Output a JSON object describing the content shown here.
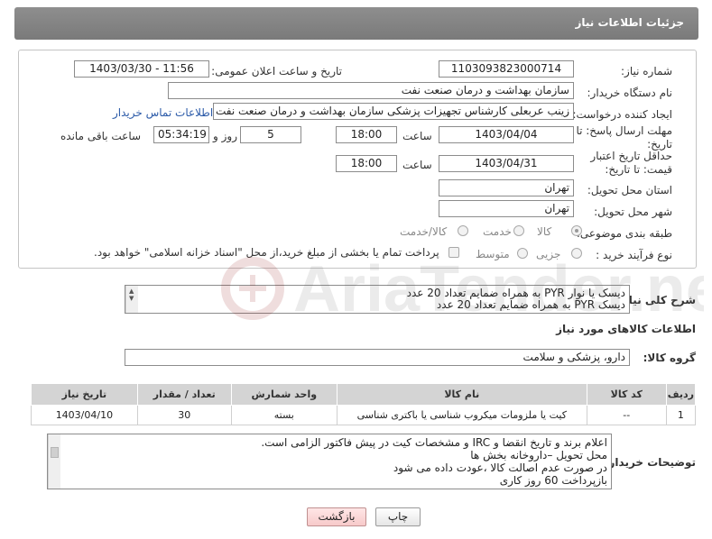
{
  "header": {
    "title": "جزئیات اطلاعات نیاز"
  },
  "form": {
    "need_number": {
      "label": "شماره نیاز:",
      "value": "1103093823000714"
    },
    "announce": {
      "label": "تاریخ و ساعت اعلان عمومی:",
      "value": "1403/03/30 - 11:56"
    },
    "buyer_org": {
      "label": "نام دستگاه خریدار:",
      "value": "سازمان بهداشت و درمان صنعت نفت"
    },
    "creator": {
      "label": "ایجاد کننده درخواست:",
      "value": "زینب عربعلی کارشناس تجهیزات پزشکی سازمان بهداشت و درمان صنعت نفت",
      "contact_link": "اطلاعات تماس خریدار"
    },
    "reply_deadline": {
      "label": "مهلت ارسال پاسخ: تا تاریخ:",
      "date": "1403/04/04",
      "time_label": "ساعت",
      "time": "18:00",
      "days": "5",
      "days_label": "روز و",
      "remaining": "05:34:19",
      "remaining_label": "ساعت باقی مانده"
    },
    "price_validity": {
      "label": "حداقل تاریخ اعتبار قیمت: تا تاریخ:",
      "date": "1403/04/31",
      "time_label": "ساعت",
      "time": "18:00"
    },
    "province": {
      "label": "استان محل تحویل:",
      "value": "تهران"
    },
    "city": {
      "label": "شهر محل تحویل:",
      "value": "تهران"
    },
    "category": {
      "label": "طبقه بندی موضوعی:",
      "options": [
        "کالا",
        "خدمت",
        "کالا/خدمت"
      ],
      "selected": "کالا"
    },
    "purchase_type": {
      "label": "نوع فرآیند خرید :",
      "options": [
        "جزیی",
        "متوسط"
      ],
      "payment_note": "پرداخت تمام یا بخشی از مبلغ خرید،از محل \"اسناد خزانه اسلامی\" خواهد بود."
    }
  },
  "description": {
    "label": "شرح کلی نیاز:",
    "lines": [
      "دیسک یا نوار PYR  به همراه ضمایم تعداد 20 عدد",
      "دیسک  PYR  به همراه ضمایم تعداد 20 عدد"
    ]
  },
  "goods_info": {
    "title": "اطلاعات کالاهای مورد نیاز"
  },
  "goods_group": {
    "label": "گروه کالا:",
    "value": "دارو، پزشکی و سلامت"
  },
  "goods_table": {
    "headers": [
      "ردیف",
      "کد کالا",
      "نام کالا",
      "واحد شمارش",
      "تعداد / مقدار",
      "تاریخ نیاز"
    ],
    "rows": [
      [
        "1",
        "--",
        "کیت یا ملزومات میکروب شناسی یا باکتری شناسی",
        "بسته",
        "30",
        "1403/04/10"
      ]
    ]
  },
  "buyer_notes": {
    "label": "توضیحات خریدار:",
    "lines": [
      "اعلام برند و تاریخ انقضا  و IRC  و مشخصات کیت در پیش فاکتور الزامی است.",
      "محل تحویل –داروخانه بخش ها",
      "در صورت عدم اصالت کالا ،عودت داده می شود",
      "بازپرداخت 60 روز کاری"
    ]
  },
  "buttons": {
    "print": "چاپ",
    "back": "بازگشت"
  },
  "watermark": {
    "text": "AriaTender.net"
  },
  "colors": {
    "header_bg": "#838383",
    "link": "#2b5aa8",
    "table_header": "#d4d4d4",
    "back_button": "#f7caca"
  }
}
